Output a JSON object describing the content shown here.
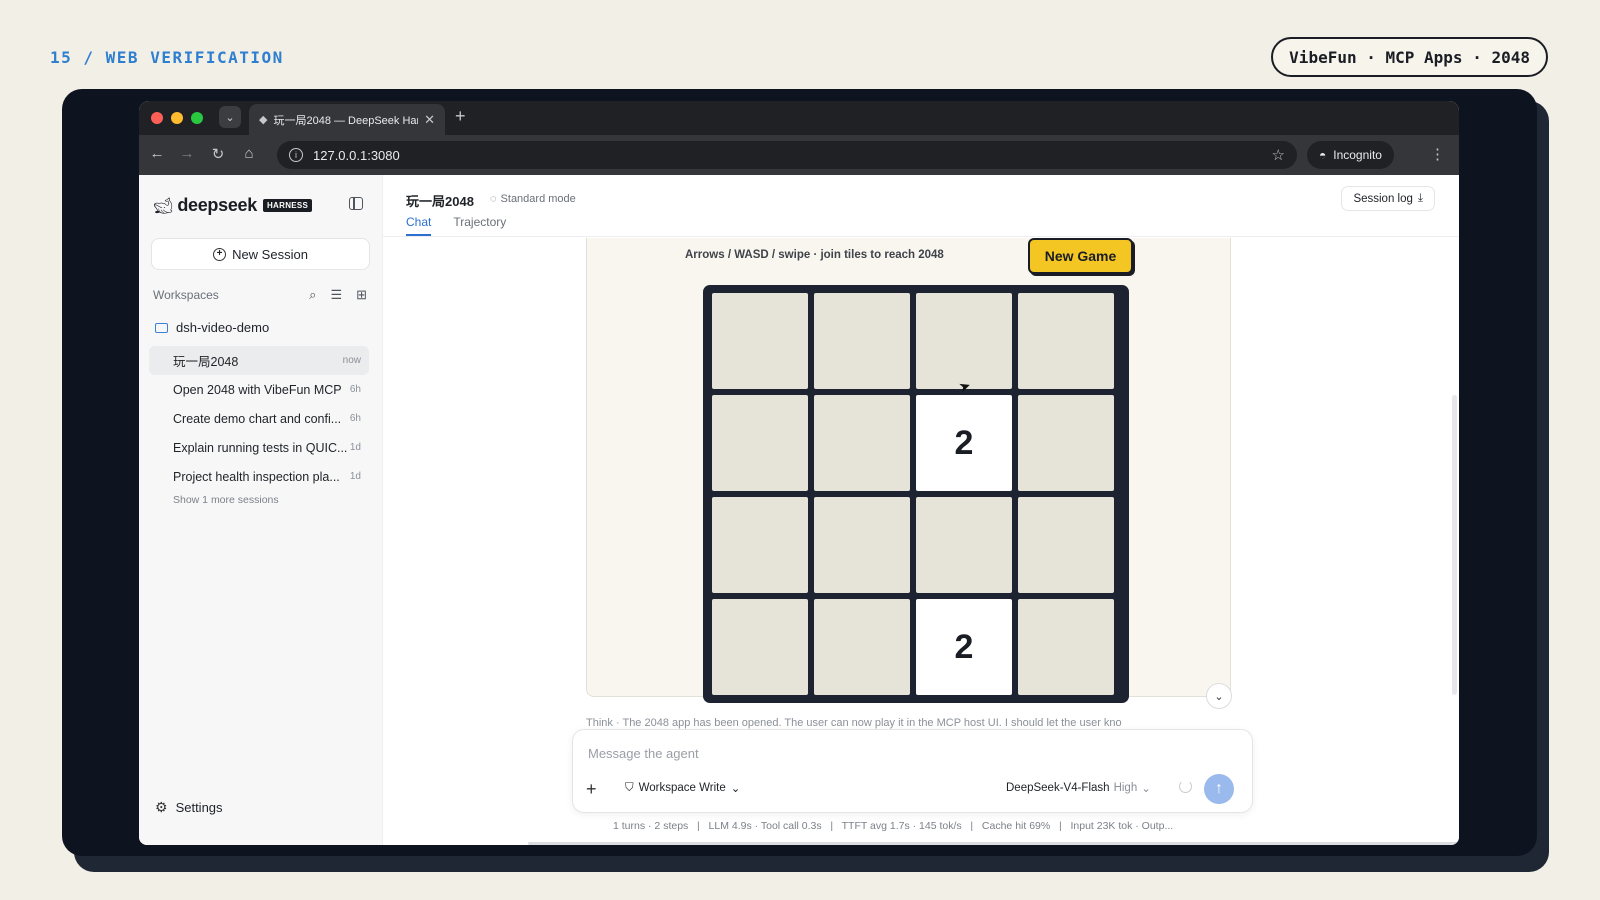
{
  "slide": {
    "label": "15 / WEB VERIFICATION",
    "pill": "VibeFun · MCP Apps · 2048"
  },
  "browser": {
    "tab_title": "玩一局2048 — DeepSeek Har",
    "url": "127.0.0.1:3080",
    "incognito_label": "Incognito",
    "icons": [
      "back-icon",
      "forward-icon",
      "reload-icon",
      "home-icon",
      "info-icon",
      "star-icon",
      "incognito-icon",
      "menu-icon"
    ]
  },
  "sidebar": {
    "logo_text": "deepseek",
    "logo_badge": "HARNESS",
    "new_session_label": "New Session",
    "workspaces_label": "Workspaces",
    "folder_name": "dsh-video-demo",
    "sessions": [
      {
        "name": "玩一局2048",
        "time": "now"
      },
      {
        "name": "Open 2048 with VibeFun MCP",
        "time": "6h"
      },
      {
        "name": "Create demo chart and confi...",
        "time": "6h"
      },
      {
        "name": "Explain running tests in QUIC...",
        "time": "1d"
      },
      {
        "name": "Project health inspection pla...",
        "time": "1d"
      }
    ],
    "show_more": "Show 1 more sessions",
    "settings_label": "Settings"
  },
  "main": {
    "session_title": "玩一局2048",
    "mode_label": "Standard mode",
    "tabs": [
      "Chat",
      "Trajectory"
    ],
    "session_log_label": "Session log"
  },
  "game": {
    "hint": "Arrows / WASD / swipe · join tiles to reach 2048",
    "new_game_label": "New Game",
    "board": [
      [
        "",
        "",
        "",
        ""
      ],
      [
        "",
        "",
        "2",
        ""
      ],
      [
        "",
        "",
        "",
        ""
      ],
      [
        "",
        "",
        "2",
        ""
      ]
    ]
  },
  "think_line": "Think · The 2048 app has been opened. The user can now play it in the MCP host UI. I should let the user kno",
  "composer": {
    "placeholder": "Message the agent",
    "workspace_mode": "Workspace Write",
    "model": "DeepSeek-V4-Flash",
    "level": "High"
  },
  "stats": {
    "turns": "1 turns · 2 steps",
    "llm": "LLM 4.9s · Tool call 0.3s",
    "ttft": "TTFT avg 1.7s · 145 tok/s",
    "cache": "Cache hit 69%",
    "tokens": "Input 23K tok · Outp..."
  },
  "colors": {
    "accent_blue": "#2c6fd1",
    "new_game_yellow": "#f3c623",
    "board_dark": "#1d2330",
    "slide_label": "#2f7fd0"
  }
}
